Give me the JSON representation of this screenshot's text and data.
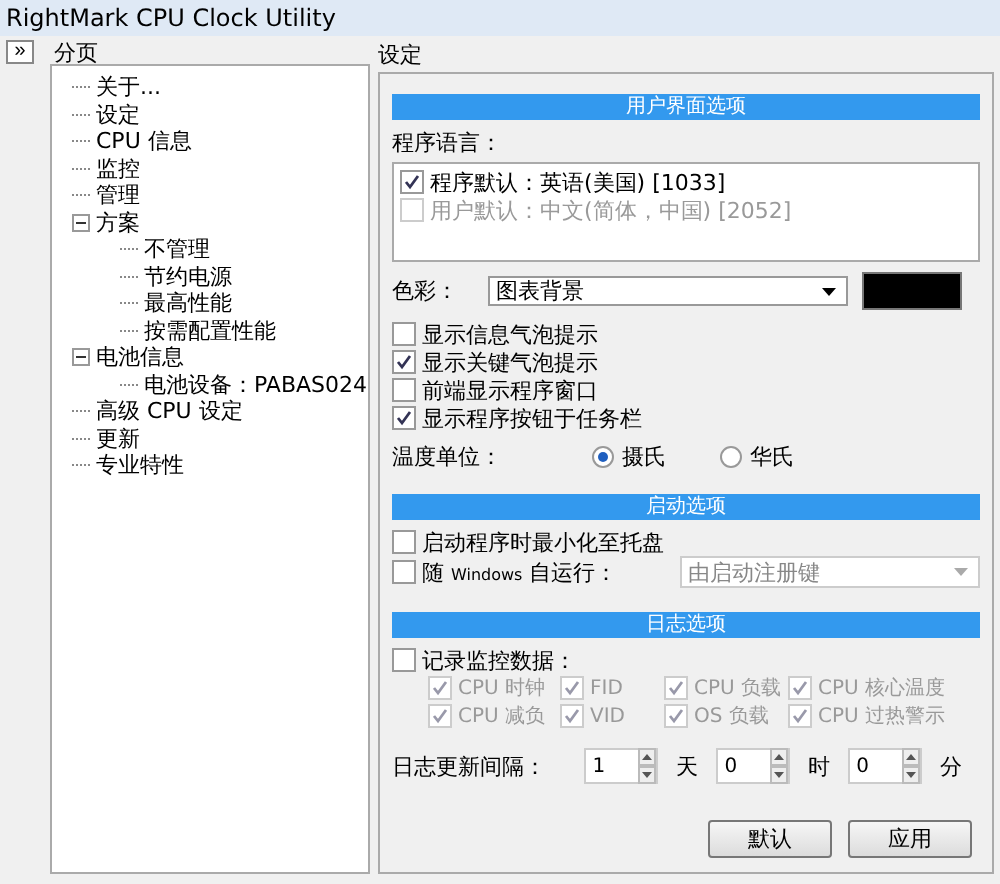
{
  "window": {
    "title": "RightMark CPU Clock Utility"
  },
  "sidebar": {
    "toggle": "»",
    "header": "分页",
    "tree": [
      {
        "label": "关于..."
      },
      {
        "label": "设定"
      },
      {
        "label": "CPU 信息"
      },
      {
        "label": "监控"
      },
      {
        "label": "管理"
      },
      {
        "label": "方案",
        "expanded": true,
        "children": [
          {
            "label": "不管理"
          },
          {
            "label": "节约电源"
          },
          {
            "label": "最高性能"
          },
          {
            "label": "按需配置性能"
          }
        ]
      },
      {
        "label": "电池信息",
        "expanded": true,
        "children": [
          {
            "label": "电池设备：PABAS024"
          }
        ]
      },
      {
        "label": "高级 CPU 设定"
      },
      {
        "label": "更新"
      },
      {
        "label": "专业特性"
      }
    ]
  },
  "settings": {
    "title": "设定",
    "ui": {
      "header": "用户界面选项",
      "language_label": "程序语言：",
      "languages": [
        {
          "label": "程序默认：英语(美国) [1033]",
          "checked": true,
          "disabled": false
        },
        {
          "label": "用户默认：中文(简体，中国) [2052]",
          "checked": false,
          "disabled": true
        }
      ],
      "color_label": "色彩：",
      "color_select": "图表背景",
      "options": [
        {
          "label": "显示信息气泡提示",
          "checked": false
        },
        {
          "label": "显示关键气泡提示",
          "checked": true
        },
        {
          "label": "前端显示程序窗口",
          "checked": false
        },
        {
          "label": "显示程序按钮于任务栏",
          "checked": true
        }
      ],
      "temp_label": "温度单位：",
      "temp_units": [
        {
          "label": "摄氏",
          "selected": true
        },
        {
          "label": "华氏",
          "selected": false
        }
      ]
    },
    "startup": {
      "header": "启动选项",
      "minimize": {
        "label": "启动程序时最小化至托盘",
        "checked": false
      },
      "autorun": {
        "label": "随 $_{Windows}$ 自运行：",
        "checked": false
      },
      "autorun_select": {
        "value": "由启动注册键",
        "disabled": true
      }
    },
    "log": {
      "header": "日志选项",
      "record": {
        "label": "记录监控数据：",
        "checked": false
      },
      "items": [
        {
          "label": "CPU 时钟",
          "checked": true,
          "disabled": true
        },
        {
          "label": "FID",
          "checked": true,
          "disabled": true
        },
        {
          "label": "CPU 负载",
          "checked": true,
          "disabled": true
        },
        {
          "label": "CPU 核心温度",
          "checked": true,
          "disabled": true
        },
        {
          "label": "CPU 减负",
          "checked": true,
          "disabled": true
        },
        {
          "label": "VID",
          "checked": true,
          "disabled": true
        },
        {
          "label": "OS 负载",
          "checked": true,
          "disabled": true
        },
        {
          "label": "CPU 过热警示",
          "checked": true,
          "disabled": true
        }
      ],
      "interval_label": "日志更新间隔：",
      "interval": [
        {
          "value": "1",
          "unit": "天"
        },
        {
          "value": "0",
          "unit": "时"
        },
        {
          "value": "0",
          "unit": "分"
        }
      ]
    },
    "buttons": [
      "默认",
      "应用"
    ]
  }
}
